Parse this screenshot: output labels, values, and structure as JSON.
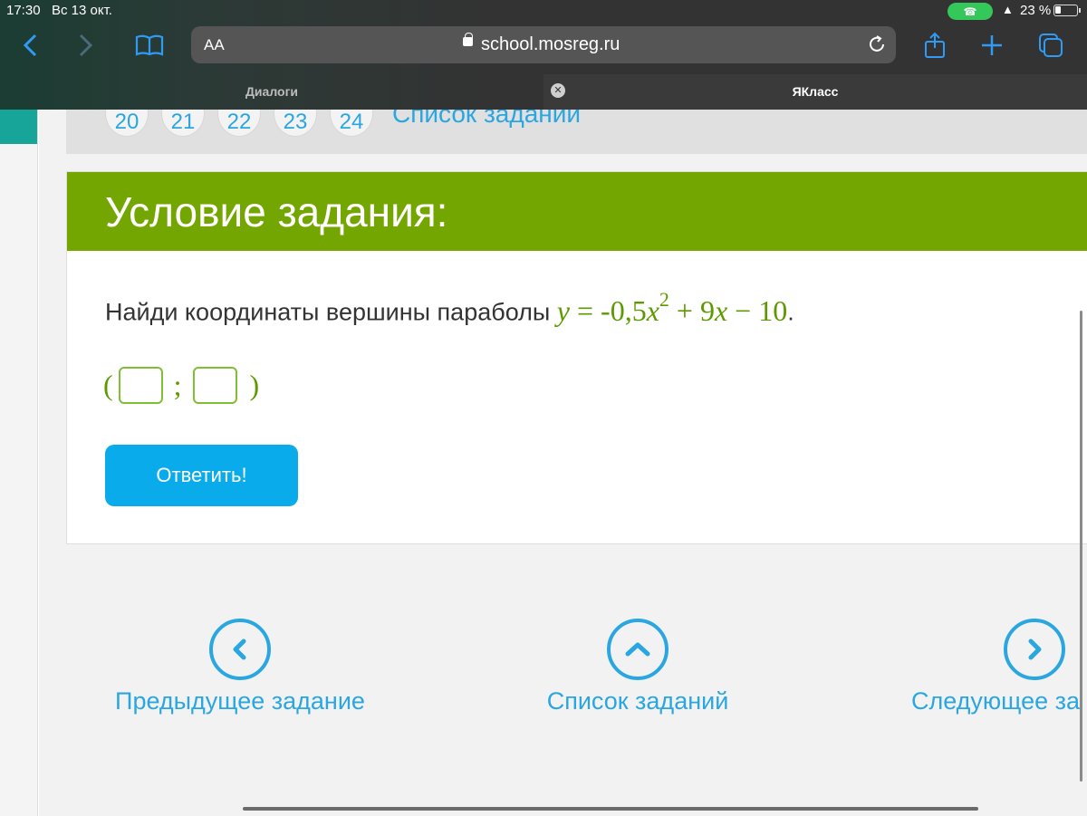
{
  "status_bar": {
    "time": "17:30",
    "date": "Вс 13 окт.",
    "battery": "23 %"
  },
  "browser": {
    "text_size_label": "AA",
    "url": "school.mosreg.ru",
    "tabs": [
      {
        "label": "Диалоги",
        "active": false
      },
      {
        "label": "ЯКласс",
        "active": true
      }
    ]
  },
  "task_numbers": {
    "items": [
      "20",
      "21",
      "22",
      "23",
      "24"
    ],
    "list_link": "Список заданий"
  },
  "task": {
    "heading": "Условие задания:",
    "question_text": "Найди координаты вершины параболы",
    "formula": {
      "y": "y",
      "eq": " = ",
      "coef": "-0,5",
      "x": "x",
      "power": "2",
      "rest_a": " + 9",
      "x2": "x",
      "rest_b": " − 10"
    },
    "question_end": ".",
    "answer": {
      "open": "(",
      "separator": ";",
      "close": ")"
    },
    "submit_label": "Ответить!"
  },
  "bottom_nav": {
    "prev_label": "Предыдущее задание",
    "list_label": "Список заданий",
    "next_label": "Следующее за"
  },
  "colors": {
    "header_green": "#73a600",
    "formula_green": "#5d9a00",
    "link_blue": "#2aa6e0",
    "button_blue": "#0aabea",
    "safari_blue": "#2f9bf5"
  }
}
